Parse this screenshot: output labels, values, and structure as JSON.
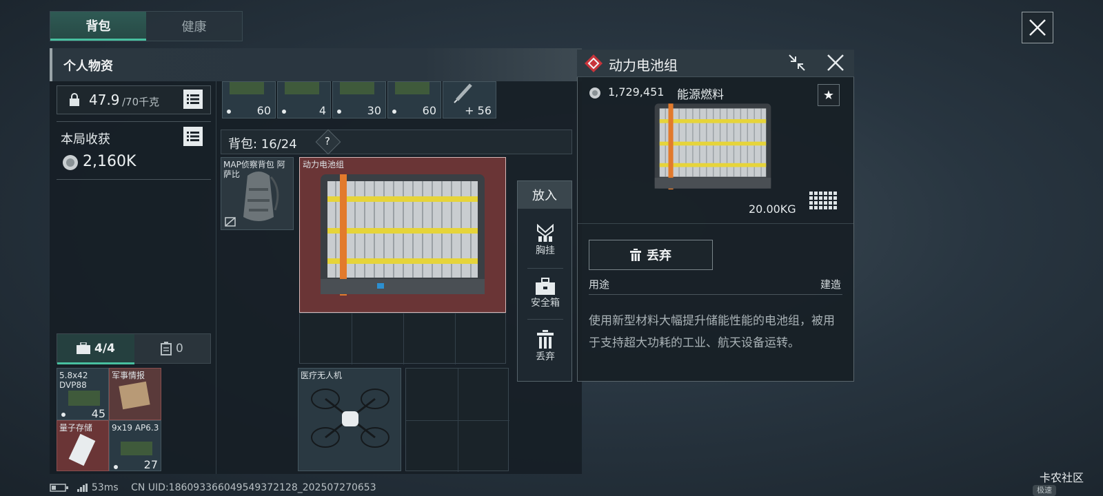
{
  "tabs": [
    "背包",
    "健康"
  ],
  "panel_title": "个人物资",
  "weight": {
    "value": "47.9",
    "max": "/70千克"
  },
  "session": {
    "label": "本局收获",
    "value": "2,160K"
  },
  "top_row_counts": [
    "60",
    "4",
    "30",
    "60",
    "+ 56"
  ],
  "backpack": {
    "label": "背包: 16/24",
    "help": "?"
  },
  "items": {
    "backpack_item": "MAP侦察背包 阿萨比",
    "battery": "动力电池组",
    "drone": "医疗无人机"
  },
  "pocket_tabs": {
    "a": "4/4",
    "b": "0"
  },
  "pocket_items": [
    {
      "label": "5.8x42 DVP88",
      "count": "45"
    },
    {
      "label": "军事情报",
      "count": ""
    },
    {
      "label": "量子存储",
      "count": ""
    },
    {
      "label": "9x19 AP6.3",
      "count": "27"
    }
  ],
  "side_panel": {
    "title": "放入",
    "btn1": "胸挂",
    "btn2": "安全箱",
    "btn3": "丢弃"
  },
  "detail": {
    "title": "动力电池组",
    "price": "1,729,451",
    "category": "能源燃料",
    "weight": "20.00KG",
    "discard": "丢弃",
    "usage_label": "用途",
    "usage_value": "建造",
    "description": "使用新型材料大幅提升储能性能的电池组，被用于支持超大功耗的工业、航天设备运转。"
  },
  "status": {
    "ping": "53ms",
    "uid": "CN UID:186093366049549372128_202507270653"
  },
  "watermark": "卡农社区",
  "fast_badge": "极速"
}
